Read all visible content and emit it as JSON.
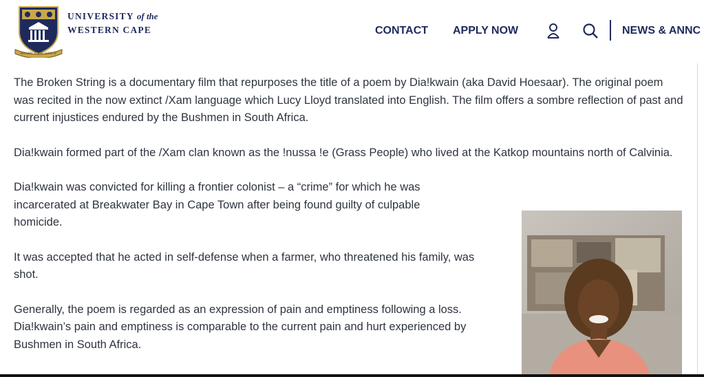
{
  "header": {
    "logo": {
      "line1_main": "UNIVERSITY",
      "line1_italic": "of the",
      "line2": "WESTERN CAPE",
      "motto": "RESPICE PROSPICE"
    },
    "nav": {
      "contact": "CONTACT",
      "apply_now": "APPLY NOW",
      "news": "NEWS & ANNC"
    },
    "icons": [
      "user-icon",
      "search-icon"
    ],
    "brand_color": "#1f2a5c"
  },
  "article": {
    "paragraphs": [
      "The Broken String is a documentary film that repurposes the title of a poem by Dia!kwain (aka David Hoesaar). The original poem was recited in the now extinct /Xam language which Lucy Lloyd translated into English. The film offers a sombre reflection of past and current injustices endured by the Bushmen in South Africa.",
      "Dia!kwain formed part of the /Xam clan known as the !nussa !e (Grass People) who lived at the Katkop mountains north of Calvinia.",
      "Dia!kwain was convicted for killing a frontier colonist – a “crime” for which he was incarcerated at Breakwater Bay in Cape Town after being found guilty of culpable homicide.",
      "It was accepted that he acted in self-defense when a farmer, who threatened his family, was shot.",
      "Generally, the poem is regarded as an expression of pain and emptiness following a loss. Dia!kwain’s pain and emptiness is comparable to the current pain and hurt experienced by Bushmen in South Africa."
    ]
  }
}
